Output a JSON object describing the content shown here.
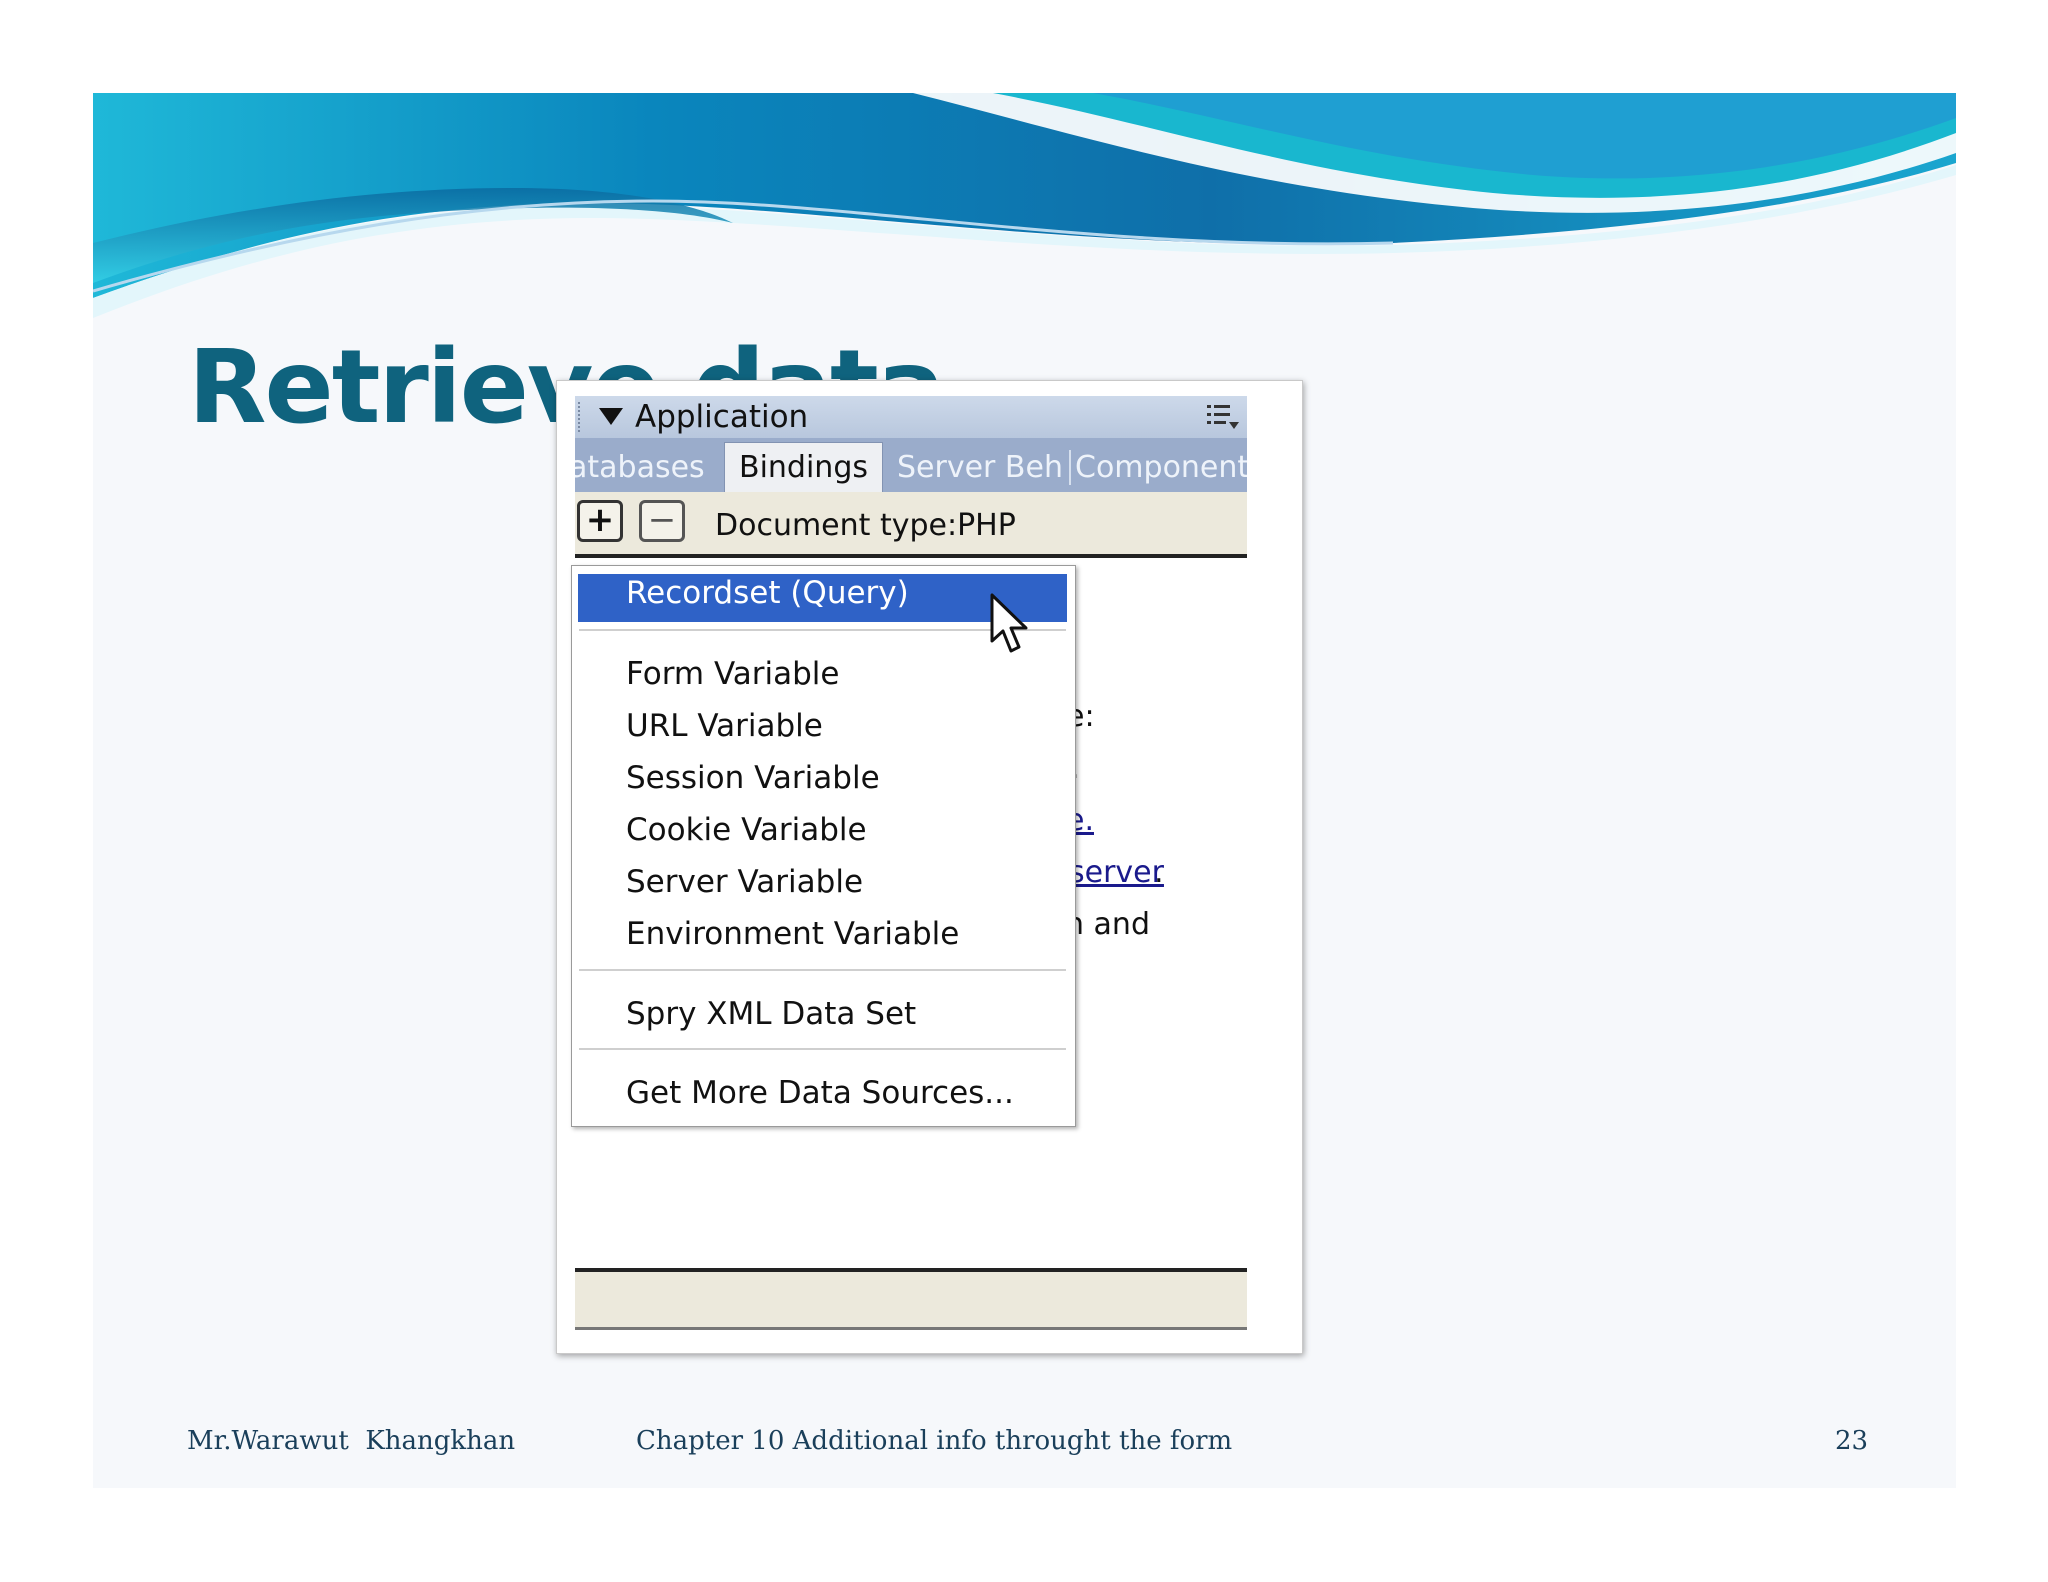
{
  "slide": {
    "title": "Retrieve data",
    "footer": {
      "author": "Mr.Warawut  Khangkhan",
      "chapter": "Chapter 10 Additional info throught the form",
      "page": "23"
    }
  },
  "panel": {
    "title": "Application",
    "tabs": [
      {
        "label": "atabases",
        "active": false
      },
      {
        "label": "Bindings",
        "active": true
      },
      {
        "label": "Server Beh",
        "active": false
      },
      {
        "label": "Component",
        "active": false
      }
    ],
    "toolbar": {
      "add_label": "+",
      "remove_label": "−",
      "doctype": "Document type:PHP"
    },
    "background_text": {
      "line1": "e:",
      "line2": ".",
      "line3": "e.",
      "line4": "server",
      "line4_suffix": ".",
      "line5": "n and"
    }
  },
  "menu": {
    "items": [
      "Recordset (Query)",
      "Form Variable",
      "URL Variable",
      "Session Variable",
      "Cookie Variable",
      "Server Variable",
      "Environment Variable",
      "Spry XML Data Set",
      "Get More Data Sources..."
    ],
    "highlighted": "Recordset (Query)"
  },
  "colors": {
    "title": "#0f637e",
    "highlight": "#2f62c7",
    "tab_bar": "#9aaccb",
    "toolbar": "#ece9dc"
  }
}
